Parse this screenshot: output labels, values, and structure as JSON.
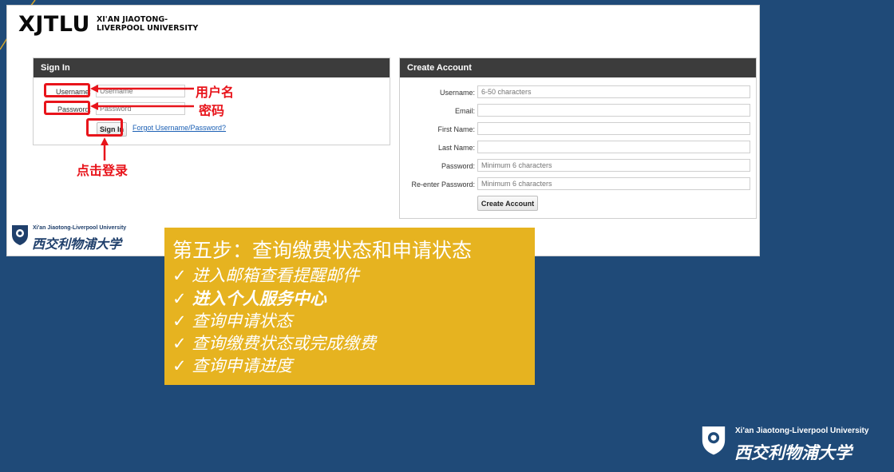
{
  "logo": {
    "short": "XJTLU",
    "line1": "XI'AN JIAOTONG-",
    "line2": "LIVERPOOL UNIVERSITY"
  },
  "signin": {
    "title": "Sign In",
    "username_label": "Username:",
    "username_placeholder": "Username",
    "password_label": "Password:",
    "password_placeholder": "Password",
    "button": "Sign In",
    "forgot_link": "Forgot Username/Password?"
  },
  "create": {
    "title": "Create Account",
    "fields": [
      {
        "label": "Username:",
        "placeholder": "6-50 characters"
      },
      {
        "label": "Email:",
        "placeholder": ""
      },
      {
        "label": "First Name:",
        "placeholder": ""
      },
      {
        "label": "Last Name:",
        "placeholder": ""
      },
      {
        "label": "Password:",
        "placeholder": "Minimum 6 characters"
      },
      {
        "label": "Re-enter Password:",
        "placeholder": "Minimum 6 characters"
      }
    ],
    "button": "Create Account"
  },
  "annotations": {
    "username": "用户名",
    "password": "密码",
    "click_login": "点击登录"
  },
  "university": {
    "en": "Xi'an Jiaotong-Liverpool University",
    "cn": "西交利物浦大学"
  },
  "step": {
    "title": "第五步：查询缴费状态和申请状态",
    "items": [
      {
        "text": "✓ 进入邮箱查看提醒邮件",
        "bold": false
      },
      {
        "text": "✓ 进入个人服务中心",
        "bold": true
      },
      {
        "text": "✓ 查询申请状态",
        "bold": false
      },
      {
        "text": "✓ 查询缴费状态或完成缴费",
        "bold": false
      },
      {
        "text": "✓ 查询申请进度",
        "bold": false
      }
    ]
  },
  "colors": {
    "background": "#1f4a78",
    "step_box": "#e6b320",
    "annotation": "#e8141b",
    "gold_line": "#d4a52a"
  },
  "icons": {
    "emblem": "university-shield-emblem",
    "arrow": "red-arrow"
  }
}
